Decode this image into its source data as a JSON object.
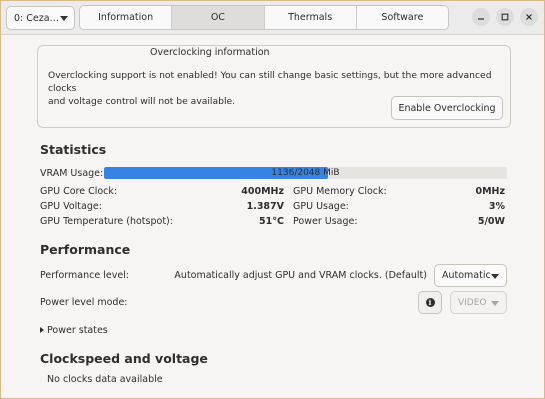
{
  "header": {
    "gpu_select": "0: Ceza…",
    "tabs": [
      {
        "label": "Information",
        "active": false
      },
      {
        "label": "OC",
        "active": true
      },
      {
        "label": "Thermals",
        "active": false
      },
      {
        "label": "Software",
        "active": false
      }
    ],
    "window_buttons": [
      "minimize-icon",
      "maximize-icon",
      "close-icon"
    ]
  },
  "oc_info": {
    "title": "Overclocking information",
    "line1": "Overclocking support is not enabled! You can still change basic settings, but the more advanced clocks",
    "line2": "and voltage control will not be available.",
    "enable_button": "Enable Overclocking"
  },
  "statistics": {
    "title": "Statistics",
    "vram_label": "VRAM Usage:",
    "vram_text": "1136/2048 MiB",
    "vram_fraction": 0.555,
    "gpu_core_clock_label": "GPU Core Clock:",
    "gpu_core_clock": "400MHz",
    "gpu_memory_clock_label": "GPU Memory Clock:",
    "gpu_memory_clock": "0MHz",
    "gpu_voltage_label": "GPU Voltage:",
    "gpu_voltage": "1.387V",
    "gpu_usage_label": "GPU Usage:",
    "gpu_usage": "3%",
    "gpu_temp_label": "GPU Temperature (hotspot):",
    "gpu_temp": "51°C",
    "power_usage_label": "Power Usage:",
    "power_usage": "5/0W"
  },
  "performance": {
    "title": "Performance",
    "level_label": "Performance level:",
    "level_desc": "Automatically adjust GPU and VRAM clocks. (Default)",
    "level_value": "Automatic",
    "power_mode_label": "Power level mode:",
    "power_mode_value": "VIDEO",
    "power_states": "Power states"
  },
  "clockspeed": {
    "title": "Clockspeed and voltage",
    "no_data": "No clocks data available"
  },
  "colors": {
    "accent": "#3584e4",
    "window_border": "#d7b98a"
  }
}
